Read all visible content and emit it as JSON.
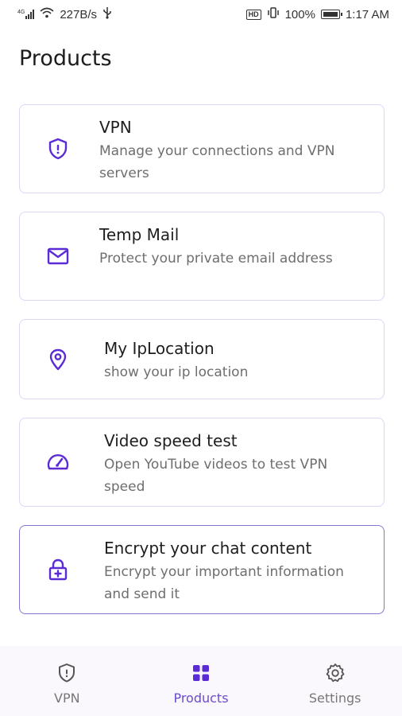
{
  "status_bar": {
    "network_type": "4G",
    "speed": "227B/s",
    "battery": "100%",
    "time": "1:17 AM",
    "icons": [
      "signal-icon",
      "wifi-icon",
      "usb-icon",
      "hd-icon",
      "vibrate-icon",
      "battery-icon"
    ]
  },
  "page": {
    "title": "Products"
  },
  "products": [
    {
      "title": "VPN",
      "description": "Manage your connections and VPN servers",
      "icon": "shield-icon"
    },
    {
      "title": "Temp Mail",
      "description": "Protect your private email address",
      "icon": "mail-icon"
    },
    {
      "title": "My IpLocation",
      "description": "show your ip location",
      "icon": "location-pin-icon"
    },
    {
      "title": "Video speed test",
      "description": "Open YouTube videos to test VPN speed",
      "icon": "speedometer-icon"
    },
    {
      "title": "Encrypt your chat content",
      "description": "Encrypt your important information and send it",
      "icon": "lock-plus-icon"
    }
  ],
  "bottom_nav": {
    "items": [
      {
        "label": "VPN",
        "icon": "shield-icon",
        "selected": false
      },
      {
        "label": "Products",
        "icon": "grid-icon",
        "selected": true
      },
      {
        "label": "Settings",
        "icon": "gear-icon",
        "selected": false
      }
    ]
  },
  "colors": {
    "accent": "#5b2bd6",
    "card_border": "#dcd6f7",
    "nav_background": "#fbf8fd",
    "nav_selected_label": "#6b4ad1"
  }
}
